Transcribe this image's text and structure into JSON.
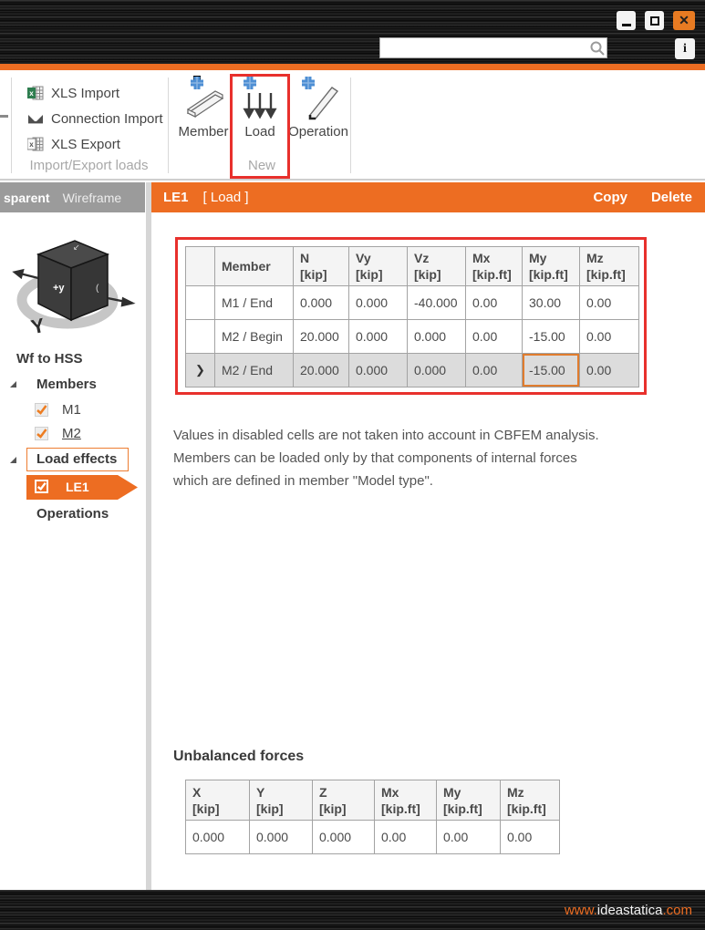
{
  "titlebar": {
    "search_value": "",
    "close_glyph": "✕",
    "info_glyph": "i"
  },
  "ribbon": {
    "groups": [
      {
        "label": "Import/Export loads",
        "items": [
          {
            "label": "XLS Import"
          },
          {
            "label": "Connection Import"
          },
          {
            "label": "XLS Export"
          }
        ]
      },
      {
        "label": "New",
        "items": [
          {
            "label": "Member"
          },
          {
            "label": "Load"
          },
          {
            "label": "Operation"
          }
        ]
      }
    ]
  },
  "view_tabs": {
    "left": "sparent",
    "right": "Wireframe"
  },
  "sidebar": {
    "project_name": "Wf to HSS",
    "cube_axis_front": "+y",
    "tree": [
      {
        "label": "Members",
        "children": [
          {
            "label": "M1",
            "checked": true
          },
          {
            "label": "M2",
            "checked": true
          }
        ]
      },
      {
        "label": "Load effects",
        "children": [
          {
            "label": "LE1",
            "checked": true,
            "selected": true
          }
        ]
      },
      {
        "label": "Operations"
      }
    ]
  },
  "detail": {
    "header": {
      "id": "LE1",
      "type": "[ Load ]",
      "copy": "Copy",
      "delete": "Delete"
    },
    "load_table": {
      "columns": [
        {
          "name": "",
          "unit": ""
        },
        {
          "name": "Member",
          "unit": ""
        },
        {
          "name": "N",
          "unit": "[kip]"
        },
        {
          "name": "Vy",
          "unit": "[kip]"
        },
        {
          "name": "Vz",
          "unit": "[kip]"
        },
        {
          "name": "Mx",
          "unit": "[kip.ft]"
        },
        {
          "name": "My",
          "unit": "[kip.ft]"
        },
        {
          "name": "Mz",
          "unit": "[kip.ft]"
        }
      ],
      "rows": [
        {
          "cells": [
            "",
            "M1 / End",
            "0.000",
            "0.000",
            "-40.000",
            "0.00",
            "30.00",
            "0.00"
          ],
          "selected": false
        },
        {
          "cells": [
            "",
            "M2 / Begin",
            "20.000",
            "0.000",
            "0.000",
            "0.00",
            "-15.00",
            "0.00"
          ],
          "selected": false
        },
        {
          "cells": [
            "❯",
            "M2 / End",
            "20.000",
            "0.000",
            "0.000",
            "0.00",
            "-15.00",
            "0.00"
          ],
          "selected": true
        }
      ]
    },
    "note": "Values in disabled cells are not taken into account in CBFEM analysis. Members can be loaded only by that components of internal forces which are defined in member \"Model type\".",
    "unbalanced": {
      "title": "Unbalanced forces",
      "columns": [
        {
          "name": "X",
          "unit": "[kip]"
        },
        {
          "name": "Y",
          "unit": "[kip]"
        },
        {
          "name": "Z",
          "unit": "[kip]"
        },
        {
          "name": "Mx",
          "unit": "[kip.ft]"
        },
        {
          "name": "My",
          "unit": "[kip.ft]"
        },
        {
          "name": "Mz",
          "unit": "[kip.ft]"
        }
      ],
      "values": [
        "0.000",
        "0.000",
        "0.000",
        "0.00",
        "0.00",
        "0.00"
      ]
    }
  },
  "footer": {
    "url_prefix": "www.",
    "url_domain": "ideastatica",
    "url_suffix": ".com"
  },
  "colors": {
    "accent": "#ed6d22",
    "highlight_red": "#e8302c",
    "blue_plus": "#4e8fd4",
    "selected_row": "#dcdcdc"
  }
}
